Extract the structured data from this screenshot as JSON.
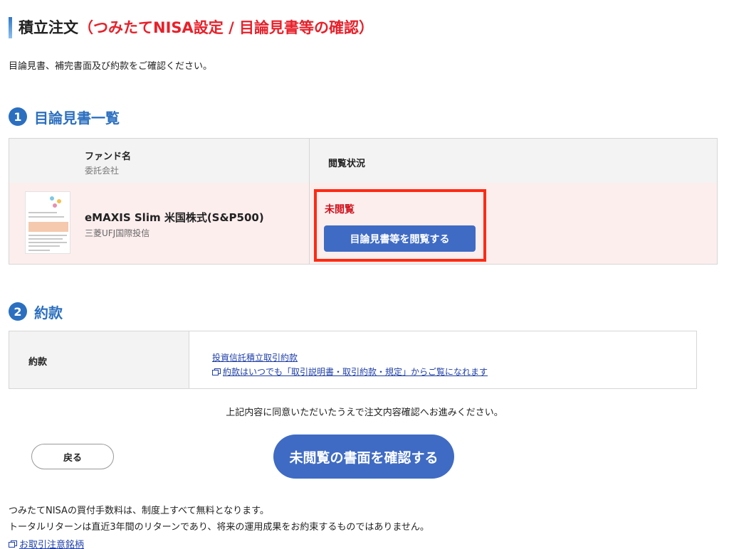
{
  "page": {
    "title_main": "積立注文",
    "title_sub": "（つみたてNISA設定 / 目論見書等の確認）",
    "intro": "目論見書、補完書面及び約款をご確認ください。"
  },
  "section1": {
    "number": "1",
    "heading": "目論見書一覧",
    "table": {
      "header_fund": "ファンド名",
      "header_company": "委託会社",
      "header_status": "閲覧状況",
      "row": {
        "fund_name": "eMAXIS Slim 米国株式(S&P500)",
        "company": "三菱UFJ国際投信",
        "status": "未閲覧",
        "view_button": "目論見書等を閲覧する"
      }
    }
  },
  "section2": {
    "number": "2",
    "heading": "約款",
    "label": "約款",
    "link_terms": "投資信託積立取引約款",
    "link_all_terms": "約款はいつでも「取引説明書・取引約款・規定」からご覧になれます"
  },
  "agreement_text": "上記内容に同意いただいたうえで注文内容確認へお進みください。",
  "buttons": {
    "back": "戻る",
    "confirm": "未閲覧の書面を確認する"
  },
  "notes": {
    "fee": "つみたてNISAの買付手数料は、制度上すべて無料となります。",
    "return": "トータルリターンは直近3年間のリターンであり、将来の運用成果をお約束するものではありません。",
    "caution_link": "お取引注意銘柄"
  },
  "colors": {
    "accent_blue": "#2b6fc0",
    "button_blue": "#3f6bc4",
    "title_red": "#e8202a",
    "status_red": "#d0101b",
    "highlight_red": "#ff2a12",
    "row_pink": "#fdeeee"
  }
}
